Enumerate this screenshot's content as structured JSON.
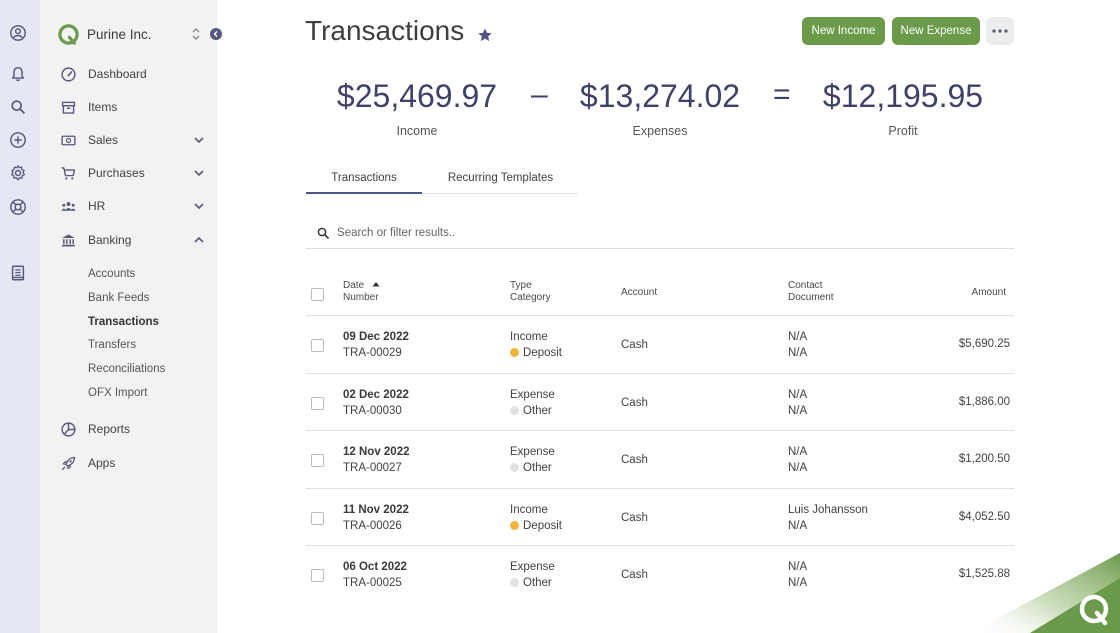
{
  "company": {
    "name": "Purine Inc."
  },
  "nav": {
    "dashboard": "Dashboard",
    "items": "Items",
    "sales": "Sales",
    "purchases": "Purchases",
    "hr": "HR",
    "banking": "Banking",
    "banking_sub": [
      "Accounts",
      "Bank Feeds",
      "Transactions",
      "Transfers",
      "Reconciliations",
      "OFX Import"
    ],
    "reports": "Reports",
    "apps": "Apps"
  },
  "page": {
    "title": "Transactions",
    "new_income": "New Income",
    "new_expense": "New Expense"
  },
  "summary": {
    "income_value": "$25,469.97",
    "income_label": "Income",
    "minus": "–",
    "expenses_value": "$13,274.02",
    "expenses_label": "Expenses",
    "equals": "=",
    "profit_value": "$12,195.95",
    "profit_label": "Profit"
  },
  "tabs": [
    "Transactions",
    "Recurring Templates"
  ],
  "search": {
    "placeholder": "Search or filter results.."
  },
  "table": {
    "headers": {
      "date": "Date",
      "number": "Number",
      "type": "Type",
      "category": "Category",
      "account": "Account",
      "contact": "Contact",
      "document": "Document",
      "amount": "Amount"
    },
    "rows": [
      {
        "date": "09 Dec 2022",
        "number": "TRA-00029",
        "type": "Income",
        "category": "Deposit",
        "account": "Cash",
        "contact": "N/A",
        "document": "N/A",
        "amount": "$5,690.25"
      },
      {
        "date": "02 Dec 2022",
        "number": "TRA-00030",
        "type": "Expense",
        "category": "Other",
        "account": "Cash",
        "contact": "N/A",
        "document": "N/A",
        "amount": "$1,886.00"
      },
      {
        "date": "12 Nov 2022",
        "number": "TRA-00027",
        "type": "Expense",
        "category": "Other",
        "account": "Cash",
        "contact": "N/A",
        "document": "N/A",
        "amount": "$1,200.50"
      },
      {
        "date": "11 Nov 2022",
        "number": "TRA-00026",
        "type": "Income",
        "category": "Deposit",
        "account": "Cash",
        "contact": "Luis Johansson",
        "document": "N/A",
        "amount": "$4,052.50"
      },
      {
        "date": "06 Oct 2022",
        "number": "TRA-00025",
        "type": "Expense",
        "category": "Other",
        "account": "Cash",
        "contact": "N/A",
        "document": "N/A",
        "amount": "$1,525.88"
      }
    ]
  },
  "colors": {
    "accent": "#6b9a4b",
    "deposit_dot": "#f0b43c",
    "other_dot": "#e1e1e1",
    "brand_dark": "#3f4268"
  }
}
